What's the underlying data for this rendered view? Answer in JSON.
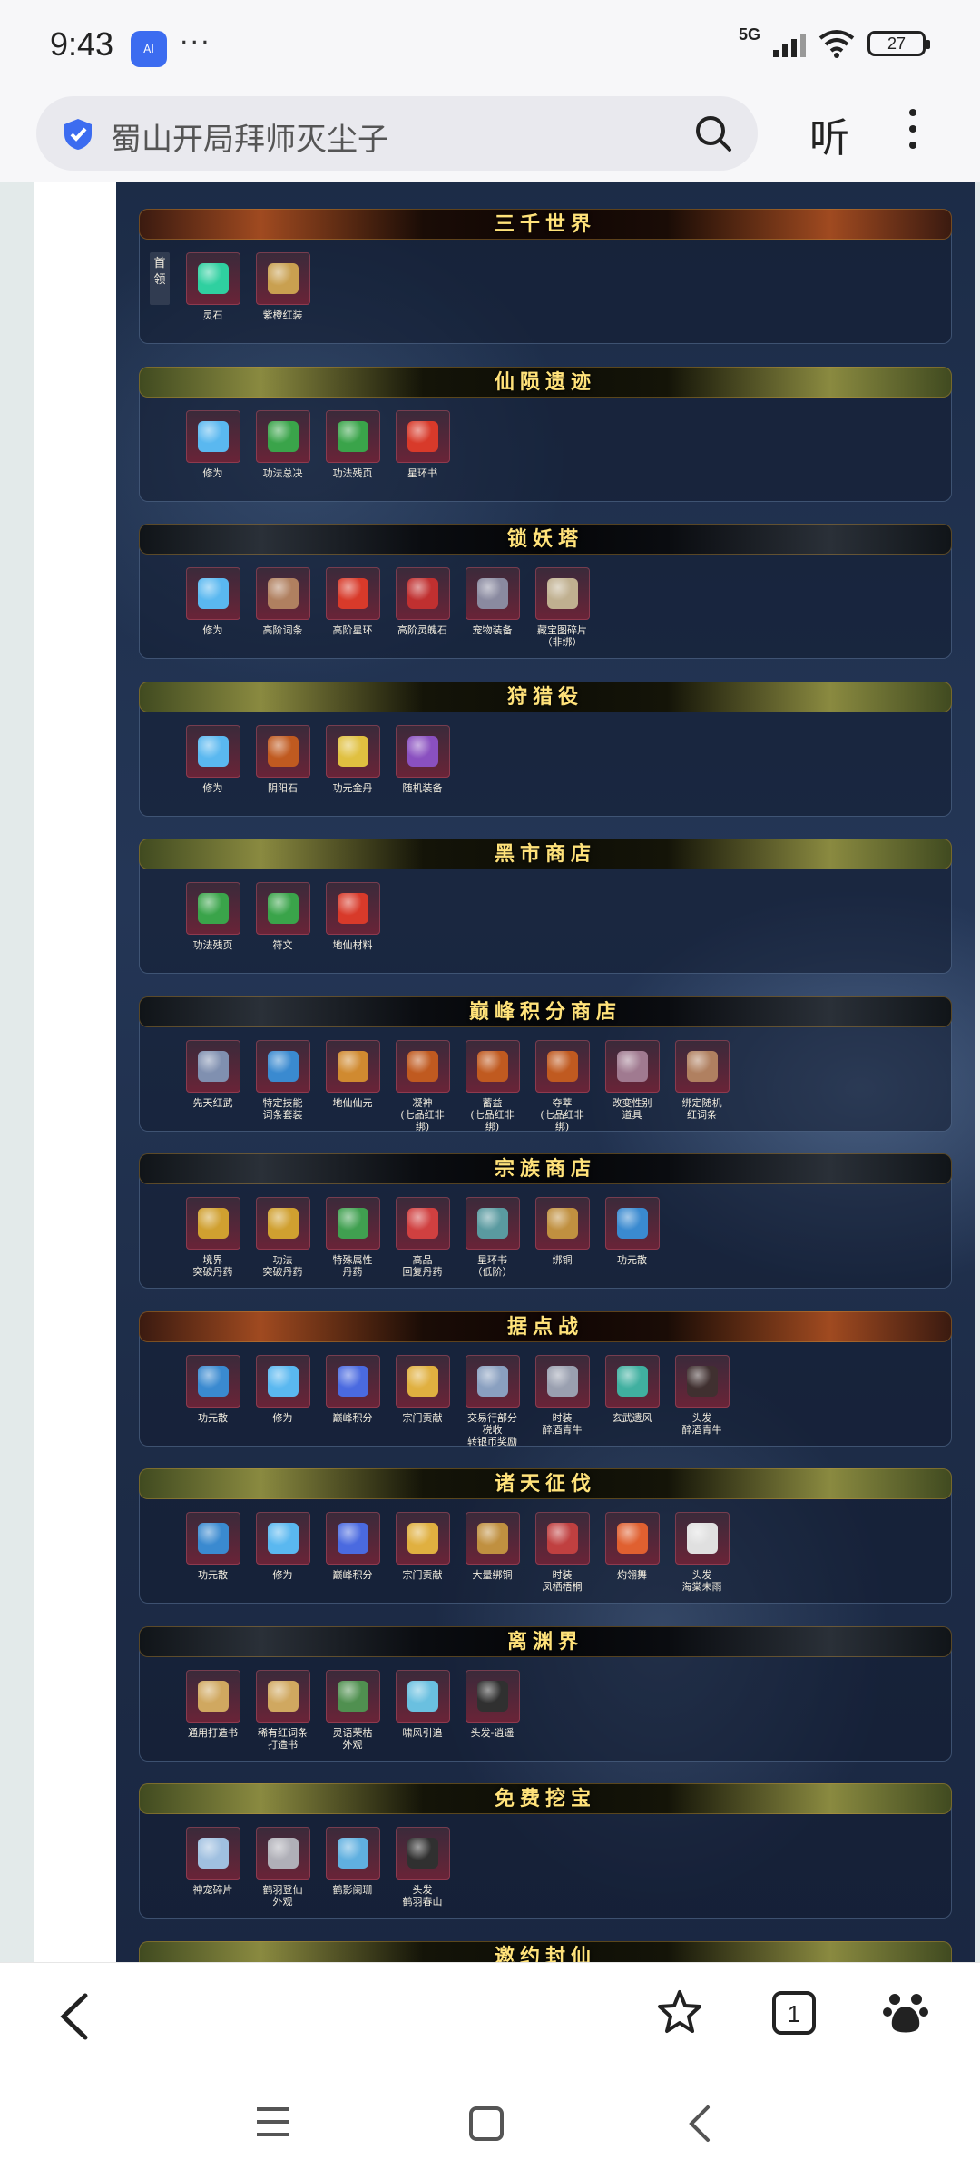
{
  "status_bar": {
    "time": "9:43",
    "app_icon_label": "AI",
    "dots": "···",
    "network": "5G",
    "battery": "27"
  },
  "search": {
    "query": "蜀山开局拜师灭尘子",
    "listen_label": "听"
  },
  "sections": [
    {
      "title": "三千世界",
      "style": "red",
      "first_tag": "首领",
      "items": [
        {
          "label": "灵石",
          "color": "#2fd0a0"
        },
        {
          "label": "紫橙红装",
          "color": "#c9a050"
        }
      ]
    },
    {
      "title": "仙陨遗迹",
      "style": "green",
      "items": [
        {
          "label": "修为",
          "color": "#5ab8f0"
        },
        {
          "label": "功法总决",
          "color": "#3aa44a"
        },
        {
          "label": "功法残页",
          "color": "#3aa44a"
        },
        {
          "label": "星环书",
          "color": "#d83a2a"
        }
      ]
    },
    {
      "title": "锁妖塔",
      "style": "dark",
      "items": [
        {
          "label": "修为",
          "color": "#5ab8f0"
        },
        {
          "label": "高阶词条",
          "color": "#b08060"
        },
        {
          "label": "高阶星环",
          "color": "#d83a2a"
        },
        {
          "label": "高阶灵魄石",
          "color": "#c03030"
        },
        {
          "label": "宠物装备",
          "color": "#8a8aa0"
        },
        {
          "label": "藏宝图碎片\n（非绑）",
          "color": "#c0b090"
        }
      ]
    },
    {
      "title": "狩猎役",
      "style": "green",
      "items": [
        {
          "label": "修为",
          "color": "#5ab8f0"
        },
        {
          "label": "阴阳石",
          "color": "#c05a20"
        },
        {
          "label": "功元金丹",
          "color": "#e0c040"
        },
        {
          "label": "随机装备",
          "color": "#8a50c0"
        }
      ]
    },
    {
      "title": "黑市商店",
      "style": "green",
      "items": [
        {
          "label": "功法残页",
          "color": "#3aa44a"
        },
        {
          "label": "符文",
          "color": "#3aa44a"
        },
        {
          "label": "地仙材料",
          "color": "#d83a2a"
        }
      ]
    },
    {
      "title": "巅峰积分商店",
      "style": "dark",
      "items": [
        {
          "label": "先天红武",
          "color": "#8090b0"
        },
        {
          "label": "特定技能\n词条套装",
          "color": "#3a8ad0"
        },
        {
          "label": "地仙仙元",
          "color": "#d08a30"
        },
        {
          "label": "凝神\n(七品红非绑)",
          "color": "#c05a20"
        },
        {
          "label": "蓄益\n(七品红非绑)",
          "color": "#c05a20"
        },
        {
          "label": "夺萃\n(七品红非绑)",
          "color": "#c05a20"
        },
        {
          "label": "改变性别\n道具",
          "color": "#a07a90"
        },
        {
          "label": "绑定随机\n红词条",
          "color": "#b08060"
        }
      ]
    },
    {
      "title": "宗族商店",
      "style": "dark",
      "items": [
        {
          "label": "境界\n突破丹药",
          "color": "#d0a030"
        },
        {
          "label": "功法\n突破丹药",
          "color": "#d0a030"
        },
        {
          "label": "特殊属性\n丹药",
          "color": "#40a050"
        },
        {
          "label": "高品\n回复丹药",
          "color": "#d04040"
        },
        {
          "label": "星环书\n（低阶）",
          "color": "#5a9aa0"
        },
        {
          "label": "绑铜",
          "color": "#c09040"
        },
        {
          "label": "功元散",
          "color": "#3a8ad0"
        }
      ]
    },
    {
      "title": "据点战",
      "style": "red",
      "items": [
        {
          "label": "功元散",
          "color": "#3a8ad0"
        },
        {
          "label": "修为",
          "color": "#5ab8f0"
        },
        {
          "label": "巅峰积分",
          "color": "#4a6ae0"
        },
        {
          "label": "宗门贡献",
          "color": "#e0b040"
        },
        {
          "label": "交易行部分税收\n转银币奖励",
          "color": "#8aa0c0"
        },
        {
          "label": "时装\n醉酒青牛",
          "color": "#9aa0b0"
        },
        {
          "label": "玄武遗风",
          "color": "#40b0a0"
        },
        {
          "label": "头发\n醉酒青牛",
          "color": "#403030"
        }
      ]
    },
    {
      "title": "诸天征伐",
      "style": "green",
      "items": [
        {
          "label": "功元散",
          "color": "#3a8ad0"
        },
        {
          "label": "修为",
          "color": "#5ab8f0"
        },
        {
          "label": "巅峰积分",
          "color": "#4a6ae0"
        },
        {
          "label": "宗门贡献",
          "color": "#e0b040"
        },
        {
          "label": "大量绑铜",
          "color": "#c09040"
        },
        {
          "label": "时装\n凤栖梧桐",
          "color": "#c04040"
        },
        {
          "label": "灼翎舞",
          "color": "#e06030"
        },
        {
          "label": "头发\n海棠未雨",
          "color": "#e0e0e0"
        }
      ]
    },
    {
      "title": "离渊界",
      "style": "dark",
      "items": [
        {
          "label": "通用打造书",
          "color": "#d0a860"
        },
        {
          "label": "稀有红词条\n打造书",
          "color": "#d0a860"
        },
        {
          "label": "灵语荣枯\n外观",
          "color": "#509050"
        },
        {
          "label": "啸风引追",
          "color": "#6ac0e0"
        },
        {
          "label": "头发-逍遥",
          "color": "#303030"
        }
      ]
    },
    {
      "title": "免费挖宝",
      "style": "green",
      "items": [
        {
          "label": "神宠碎片",
          "color": "#a0c0e0"
        },
        {
          "label": "鹤羽登仙\n外观",
          "color": "#b0b0b8"
        },
        {
          "label": "鹤影阑珊",
          "color": "#60b0e0"
        },
        {
          "label": "头发\n鹤羽春山",
          "color": "#303030"
        }
      ]
    },
    {
      "title": "邀约封仙",
      "style": "green",
      "items": []
    }
  ]
}
